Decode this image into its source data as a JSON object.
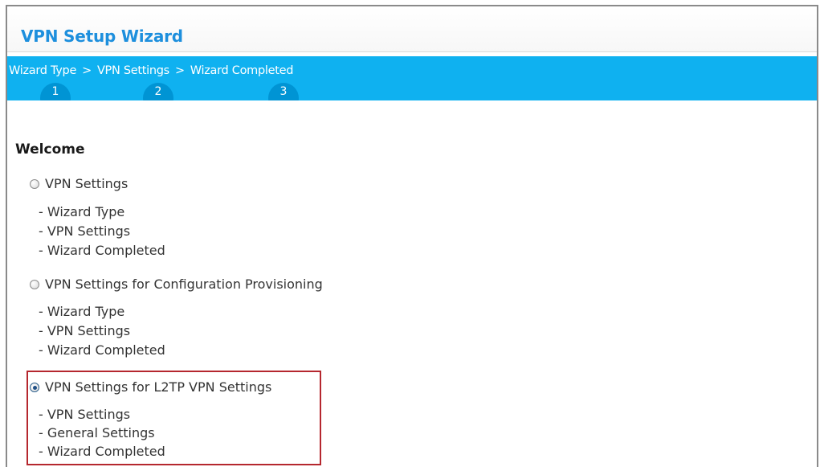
{
  "wizard": {
    "title": "VPN Setup Wizard",
    "steps": [
      {
        "label": "Wizard Type",
        "number": "1"
      },
      {
        "label": "VPN Settings",
        "number": "2"
      },
      {
        "label": "Wizard Completed",
        "number": "3"
      }
    ],
    "separator": ">"
  },
  "welcome": {
    "heading": "Welcome",
    "options": [
      {
        "label": "VPN Settings",
        "selected": false,
        "items": [
          "- Wizard Type",
          "- VPN Settings",
          "- Wizard Completed"
        ]
      },
      {
        "label": "VPN Settings for Configuration Provisioning",
        "selected": false,
        "items": [
          "- Wizard Type",
          "- VPN Settings",
          "- Wizard Completed"
        ]
      },
      {
        "label": "VPN Settings for L2TP VPN Settings",
        "selected": true,
        "items": [
          "- VPN Settings",
          "- General Settings",
          "- Wizard Completed"
        ]
      }
    ]
  },
  "colors": {
    "title": "#1d8fdd",
    "stepbar": "#0fb1f0",
    "step_circle": "#0094d4",
    "highlight_border": "#b5272e"
  }
}
